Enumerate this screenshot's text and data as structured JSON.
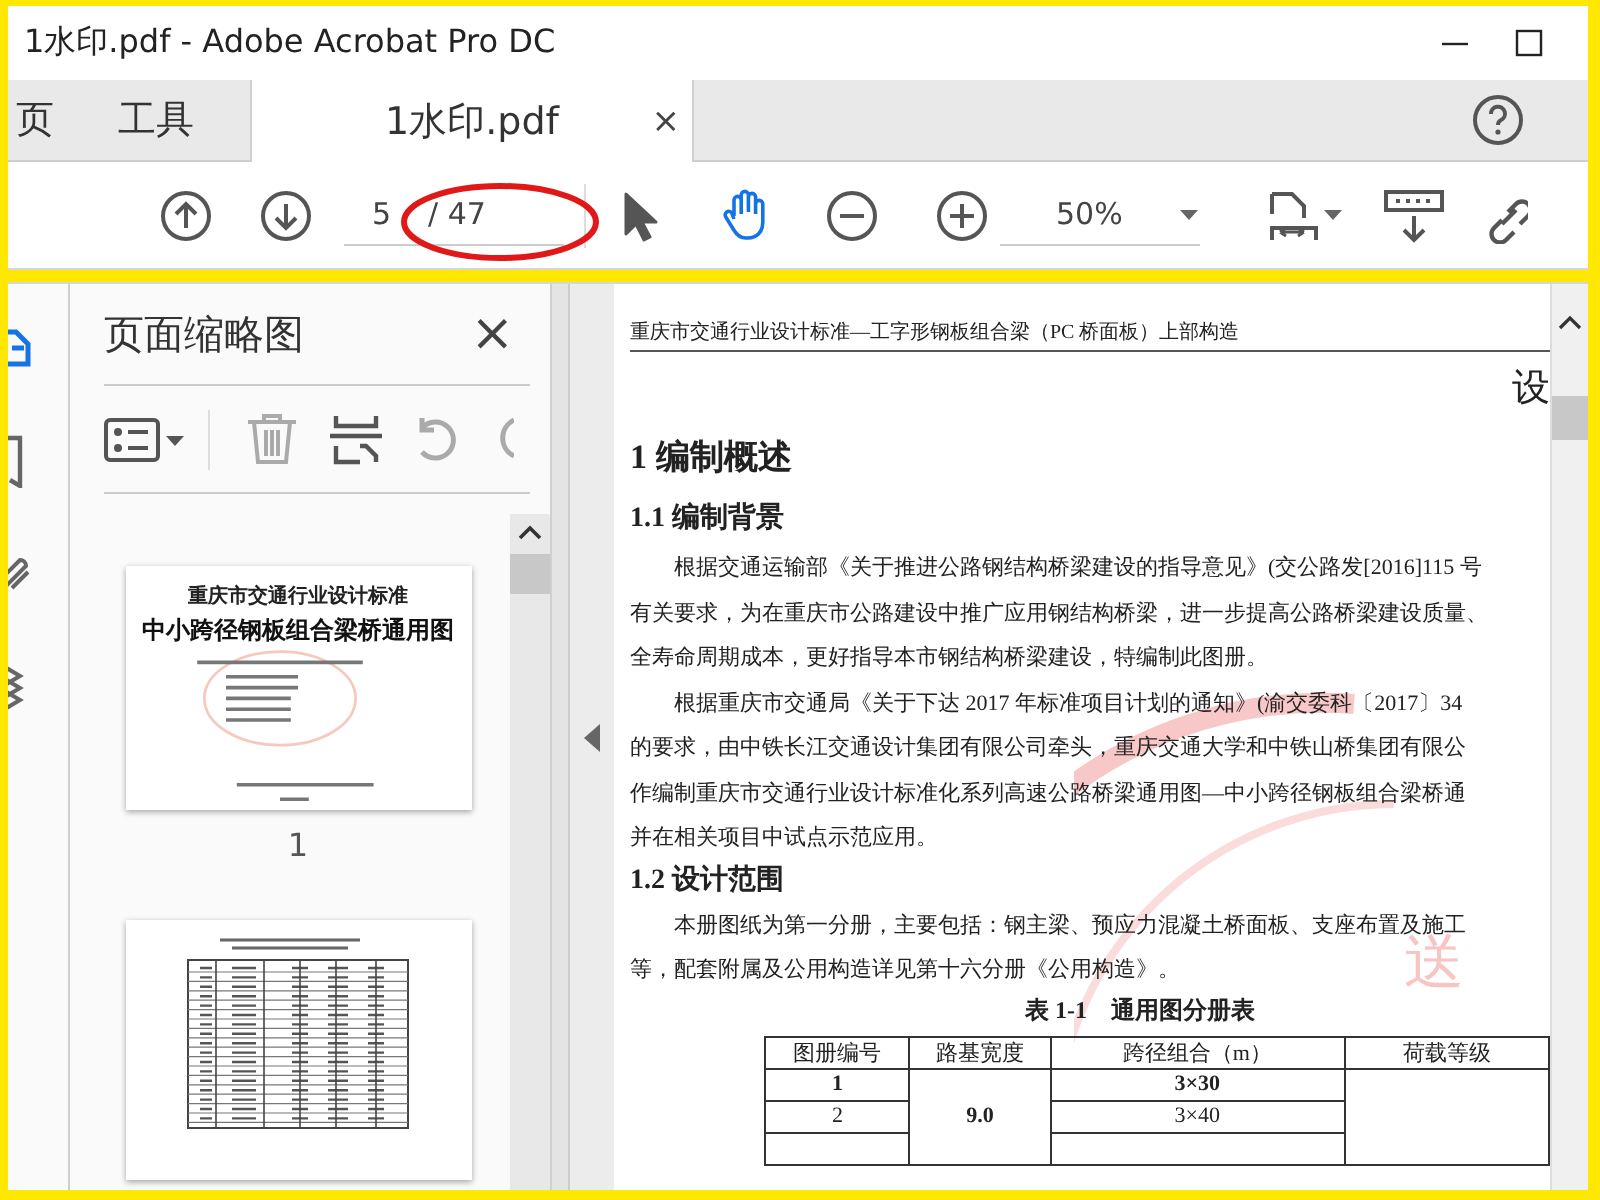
{
  "window": {
    "title": "1水印.pdf - Adobe Acrobat Pro DC"
  },
  "tabs": [
    {
      "label": "页",
      "selected": false,
      "kind": "nav"
    },
    {
      "label": "工具",
      "selected": false,
      "kind": "nav"
    },
    {
      "label": "1水印.pdf",
      "selected": true,
      "kind": "document",
      "close": "×"
    }
  ],
  "toolbar": {
    "page_field": {
      "value": "5"
    },
    "page_total": "/ 47",
    "tools": [
      {
        "kind": "select",
        "selected": false
      },
      {
        "kind": "hand",
        "selected": true
      }
    ],
    "zoom": {
      "value": "50%"
    }
  },
  "sidebar": {
    "title": "页面缩略图",
    "close": "×",
    "thumbnails": [
      {
        "kind": "cover",
        "heading": "重庆市交通行业设计标准",
        "title": "中小跨径钢板组合梁桥通用图",
        "page_label": "1"
      },
      {
        "kind": "table"
      }
    ]
  },
  "document": {
    "running_header": "重庆市交通行业设计标准—工字形钢板组合梁（PC 桥面板）上部构造",
    "title_fragment": "设",
    "stamp": "送",
    "blocks": [
      {
        "kind": "h1",
        "text": "1 编制概述"
      },
      {
        "kind": "h2",
        "text": "1.1 编制背景"
      },
      {
        "kind": "line",
        "indent": true,
        "text": "根据交通运输部《关于推进公路钢结构桥梁建设的指导意见》(交公路发[2016]115 号"
      },
      {
        "kind": "line",
        "indent": false,
        "text": "有关要求，为在重庆市公路建设中推广应用钢结构桥梁，进一步提高公路桥梁建设质量、"
      },
      {
        "kind": "line",
        "indent": false,
        "text": "全寿命周期成本，更好指导本市钢结构桥梁建设，特编制此图册。"
      },
      {
        "kind": "line",
        "indent": true,
        "text": "根据重庆市交通局《关于下达 2017 年标准项目计划的通知》(渝交委科〔2017〕34"
      },
      {
        "kind": "line",
        "indent": false,
        "text": "的要求，由中铁长江交通设计集团有限公司牵头，重庆交通大学和中铁山桥集团有限公"
      },
      {
        "kind": "line",
        "indent": false,
        "text": "作编制重庆市交通行业设计标准化系列高速公路桥梁通用图—中小跨径钢板组合梁桥通"
      },
      {
        "kind": "line",
        "indent": false,
        "text": "并在相关项目中试点示范应用。"
      },
      {
        "kind": "h2",
        "text": "1.2 设计范围"
      },
      {
        "kind": "line",
        "indent": true,
        "text": "本册图纸为第一分册，主要包括：钢主梁、预应力混凝土桥面板、支座布置及施工"
      },
      {
        "kind": "line",
        "indent": false,
        "text": "等，配套附属及公用构造详见第十六分册《公用构造》。"
      },
      {
        "kind": "caption",
        "text": "表 1-1　通用图分册表"
      }
    ],
    "table": {
      "columns": [
        "图册编号",
        "路基宽度",
        "跨径组合（m）",
        "荷载等级"
      ],
      "group_value": "9.0",
      "rows": [
        {
          "number": "1",
          "span": "3×30",
          "bold": true
        },
        {
          "number": "2",
          "span": "3×40",
          "bold": false
        }
      ]
    }
  },
  "annotation": {
    "kind": "ellipse"
  }
}
